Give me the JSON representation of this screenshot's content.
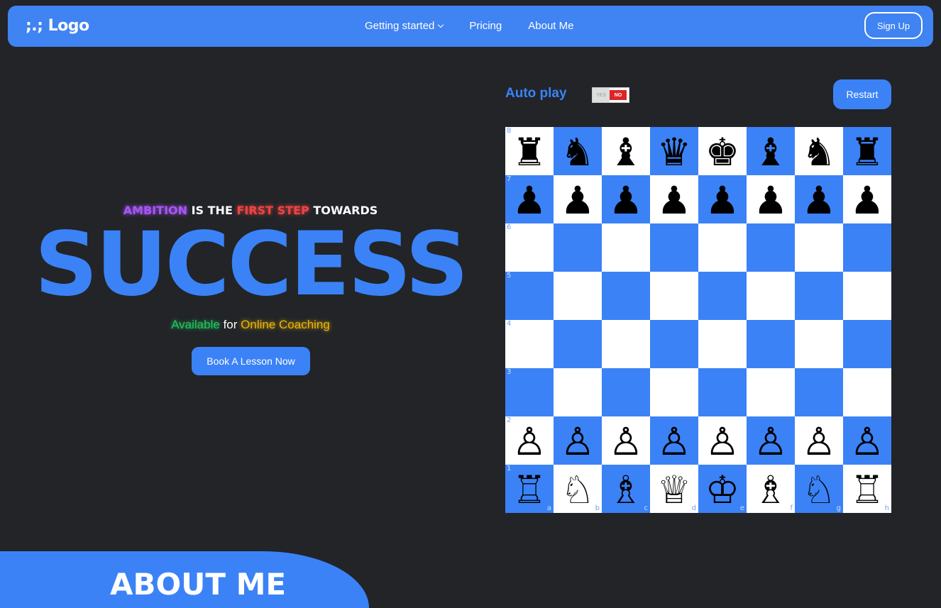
{
  "nav": {
    "logo": ";.; Logo",
    "links": [
      "Getting started",
      "Pricing",
      "About Me"
    ],
    "signup": "Sign Up"
  },
  "hero": {
    "tag_ambition": "AMBITION",
    "tag_is_the": "IS THE",
    "tag_first_step": "FIRST STEP",
    "tag_towards": "TOWARDS",
    "title": "SUCCESS",
    "avail_available": "Available",
    "avail_for": "for",
    "avail_online": "Online Coaching",
    "cta": "Book A Lesson Now"
  },
  "game": {
    "autoplay_label": "Auto play",
    "toggle_yes": "YES",
    "toggle_no": "NO",
    "restart": "Restart",
    "files": [
      "a",
      "b",
      "c",
      "d",
      "e",
      "f",
      "g",
      "h"
    ],
    "ranks": [
      "8",
      "7",
      "6",
      "5",
      "4",
      "3",
      "2",
      "1"
    ],
    "board": [
      [
        "♜",
        "♞",
        "♝",
        "♛",
        "♚",
        "♝",
        "♞",
        "♜"
      ],
      [
        "♟",
        "♟",
        "♟",
        "♟",
        "♟",
        "♟",
        "♟",
        "♟"
      ],
      [
        "",
        "",
        "",
        "",
        "",
        "",
        "",
        ""
      ],
      [
        "",
        "",
        "",
        "",
        "",
        "",
        "",
        ""
      ],
      [
        "",
        "",
        "",
        "",
        "",
        "",
        "",
        ""
      ],
      [
        "",
        "",
        "",
        "",
        "",
        "",
        "",
        ""
      ],
      [
        "♙",
        "♙",
        "♙",
        "♙",
        "♙",
        "♙",
        "♙",
        "♙"
      ],
      [
        "♖",
        "♘",
        "♗",
        "♕",
        "♔",
        "♗",
        "♘",
        "♖"
      ]
    ]
  },
  "about": {
    "title": "ABOUT ME"
  },
  "colors": {
    "brand": "#3b82f6",
    "background": "#222428"
  }
}
